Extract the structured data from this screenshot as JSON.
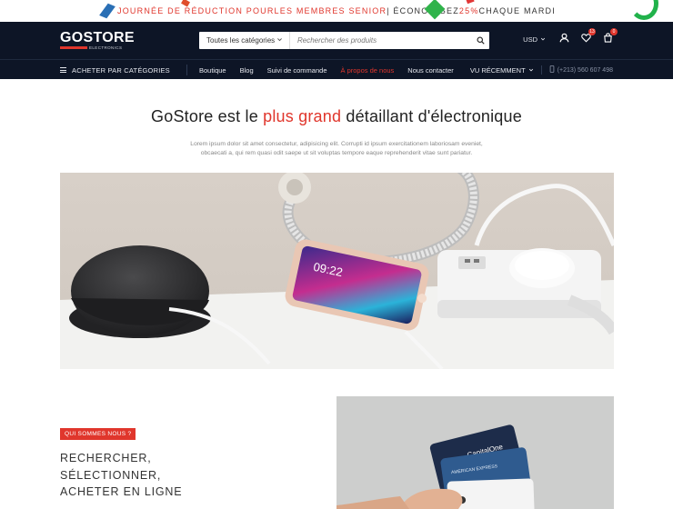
{
  "promo": {
    "part1": "JOURNÉE DE RÉDUCTION POUR ",
    "part2": "LES MEMBRES SENIOR",
    "part3": " | ÉCONOMISEZ ",
    "part4": "25%",
    "part5": " CHAQUE MARDI"
  },
  "brand": {
    "name": "GOSTORE",
    "tagline": "ELECTRONICS",
    "accent": "#e0362c",
    "dark": "#0d1526"
  },
  "search": {
    "category": "Toutes les catégories",
    "placeholder": "Rechercher des produits"
  },
  "header": {
    "currency": "USD",
    "wishlist_count": "13",
    "cart_count": "0"
  },
  "nav": {
    "categories_label": "ACHETER PAR CATÉGORIES",
    "links": [
      "Boutique",
      "Blog",
      "Suivi de commande",
      "À propos de nous",
      "Nous contacter"
    ],
    "active_link": "À propos de nous",
    "recent_label": "VU RÉCEMMENT",
    "phone": "(+213) 560 607 498"
  },
  "hero": {
    "title_pre": "GoStore est le ",
    "title_highlight": "plus grand",
    "title_post": " détaillant d'électronique",
    "description": "Lorem ipsum dolor sit amet consectetur, adipisicing elit. Corrupti id ipsum exercitationem laboriosam eveniet, obcaecati a, qui rem quasi odit saepe ut sit voluptas tempore eaque reprehenderit vitae sunt pariatur.",
    "phone_time": "09:22"
  },
  "about": {
    "badge": "QUI SOMMES NOUS ?",
    "heading_lines": [
      "RECHERCHER,",
      "SÉLECTIONNER,",
      "ACHETER EN LIGNE"
    ],
    "card_labels": [
      "CapitalOne",
      "AMERICAN EXPRESS"
    ]
  }
}
